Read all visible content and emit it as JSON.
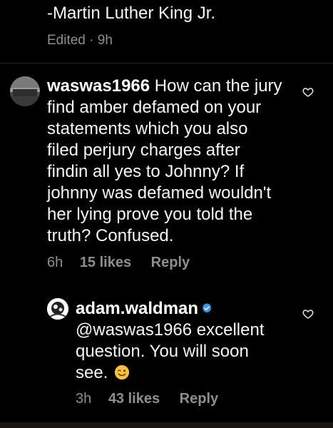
{
  "previous_comment": {
    "text_tail": "-Martin Luther King Jr.",
    "meta": "Edited · 9h"
  },
  "comments": [
    {
      "username": "waswas1966",
      "body": "How can the jury find amber defamed on your statements which you also filed perjury charges after findin all yes to Johnny? If johnny was defamed wouldn't her lying prove you told the truth? Confused.",
      "time": "6h",
      "likes": "15 likes",
      "reply_label": "Reply"
    },
    {
      "username": "adam.waldman",
      "verified": true,
      "body": "@waswas1966 excellent question. You will soon see.",
      "emoji": "winking-face-with-tongue",
      "time": "3h",
      "likes": "43 likes",
      "reply_label": "Reply"
    }
  ],
  "colors": {
    "background": "#000000",
    "primary_text": "#f5f5f5",
    "secondary_text": "#8e8e8e",
    "verified_badge": "#3897f0"
  },
  "icons": {
    "like": "heart-outline-icon",
    "verified": "verified-badge-icon"
  }
}
